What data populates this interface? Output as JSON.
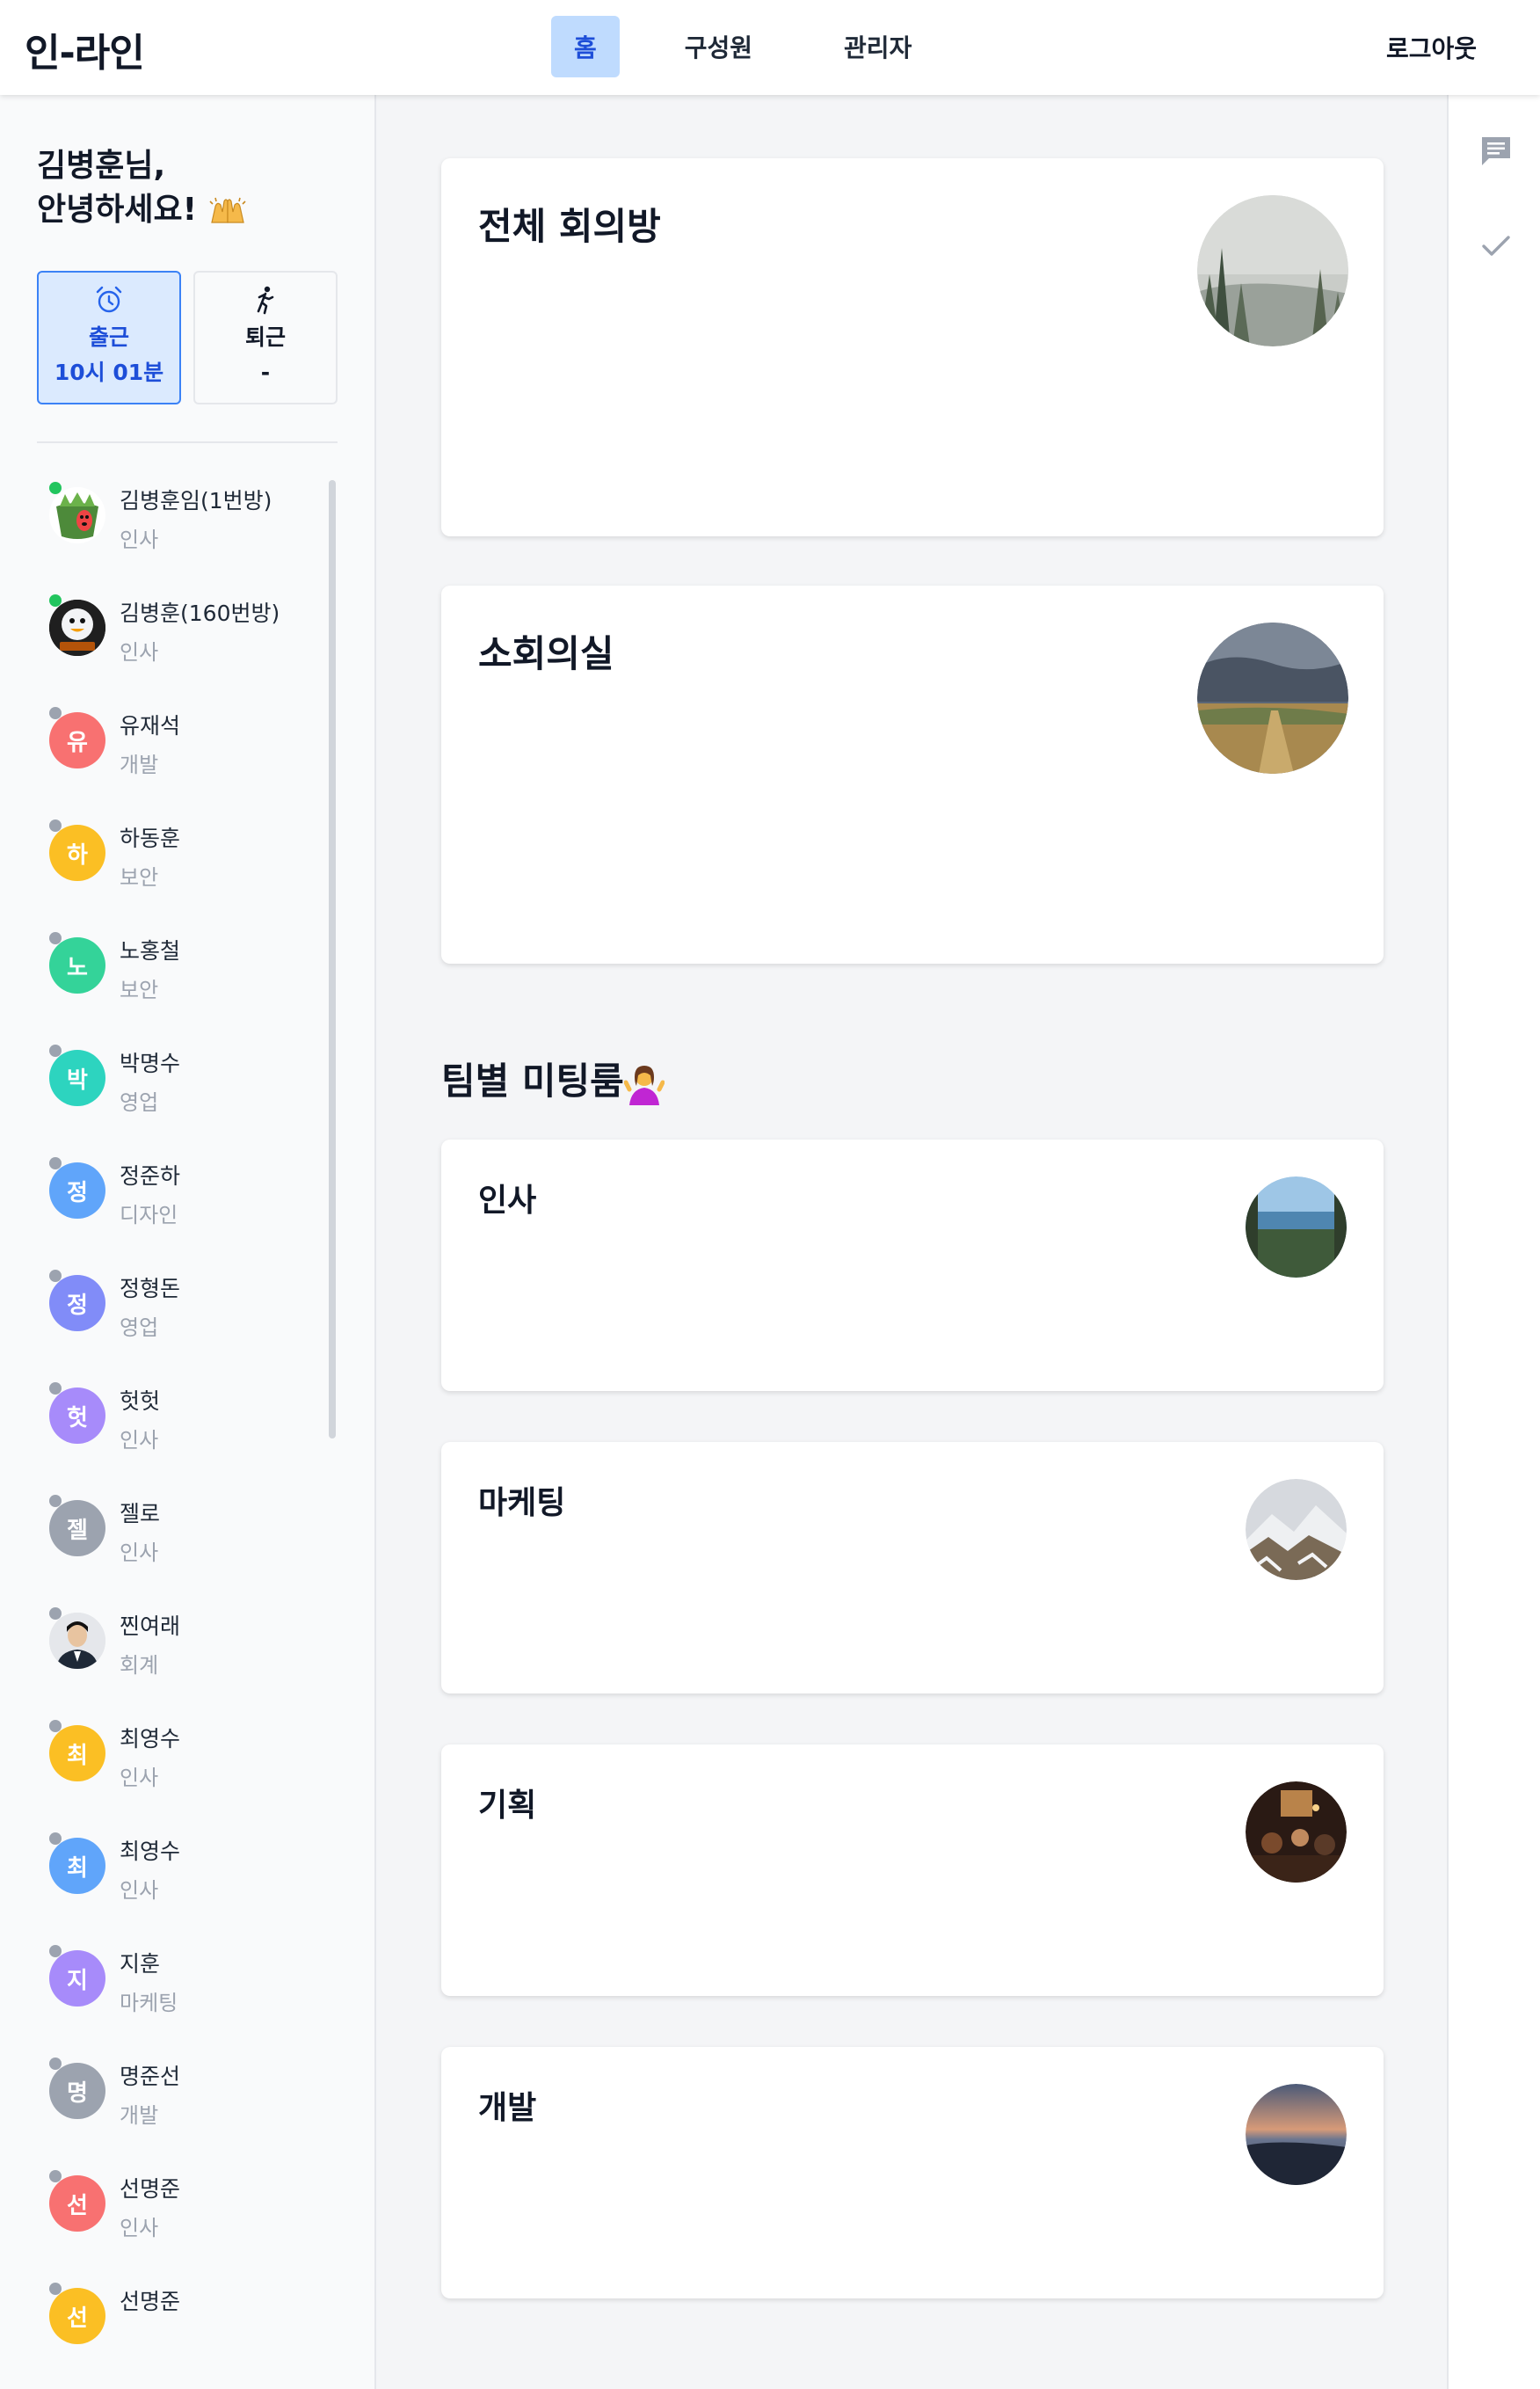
{
  "app": {
    "title": "인-라인"
  },
  "nav": {
    "items": [
      "홈",
      "구성원",
      "관리자"
    ],
    "active_index": 0,
    "logout": "로그아웃"
  },
  "colors": {
    "accent": "#3b82f6",
    "active_tab_bg": "#bfdbfe",
    "online": "#22c55e",
    "offline": "#9ca3af"
  },
  "sidebar": {
    "greeting_line1": "김병훈님,",
    "greeting_line2": "안녕하세요!",
    "greeting_icon": "raising-hands-emoji",
    "clock_in": {
      "icon": "alarm-clock-icon",
      "label": "출근",
      "time": "10시 01분"
    },
    "clock_out": {
      "icon": "walking-person-icon",
      "label": "퇴근",
      "time": "-"
    },
    "members": [
      {
        "name": "김병훈임(1번방)",
        "dept": "인사",
        "online": true,
        "avatar": "image",
        "initial": ""
      },
      {
        "name": "김병훈(160번방)",
        "dept": "인사",
        "online": true,
        "avatar": "image",
        "initial": ""
      },
      {
        "name": "유재석",
        "dept": "개발",
        "online": false,
        "avatar": "initial",
        "initial": "유",
        "color": "#f87171"
      },
      {
        "name": "하동훈",
        "dept": "보안",
        "online": false,
        "avatar": "initial",
        "initial": "하",
        "color": "#fbbf24"
      },
      {
        "name": "노홍철",
        "dept": "보안",
        "online": false,
        "avatar": "initial",
        "initial": "노",
        "color": "#34d399"
      },
      {
        "name": "박명수",
        "dept": "영업",
        "online": false,
        "avatar": "initial",
        "initial": "박",
        "color": "#2dd4bf"
      },
      {
        "name": "정준하",
        "dept": "디자인",
        "online": false,
        "avatar": "initial",
        "initial": "정",
        "color": "#60a5fa"
      },
      {
        "name": "정형돈",
        "dept": "영업",
        "online": false,
        "avatar": "initial",
        "initial": "정",
        "color": "#818cf8"
      },
      {
        "name": "헛헛",
        "dept": "인사",
        "online": false,
        "avatar": "initial",
        "initial": "헛",
        "color": "#a78bfa"
      },
      {
        "name": "젤로",
        "dept": "인사",
        "online": false,
        "avatar": "initial",
        "initial": "젤",
        "color": "#9ca3af"
      },
      {
        "name": "찐여래",
        "dept": "회계",
        "online": false,
        "avatar": "image",
        "initial": ""
      },
      {
        "name": "최영수",
        "dept": "인사",
        "online": false,
        "avatar": "initial",
        "initial": "최",
        "color": "#fbbf24"
      },
      {
        "name": "최영수",
        "dept": "인사",
        "online": false,
        "avatar": "initial",
        "initial": "최",
        "color": "#60a5fa"
      },
      {
        "name": "지훈",
        "dept": "마케팅",
        "online": false,
        "avatar": "initial",
        "initial": "지",
        "color": "#a78bfa"
      },
      {
        "name": "명준선",
        "dept": "개발",
        "online": false,
        "avatar": "initial",
        "initial": "명",
        "color": "#9ca3af"
      },
      {
        "name": "선명준",
        "dept": "인사",
        "online": false,
        "avatar": "initial",
        "initial": "선",
        "color": "#f87171"
      },
      {
        "name": "선명준",
        "dept": "",
        "online": false,
        "avatar": "initial",
        "initial": "선",
        "color": "#fbbf24"
      }
    ]
  },
  "rail": {
    "icons": [
      "chat-icon",
      "check-icon"
    ]
  },
  "main": {
    "rooms": [
      {
        "title": "전체 회의방",
        "image": "misty-forest"
      },
      {
        "title": "소회의실",
        "image": "field-under-clouds"
      }
    ],
    "team_section_title": "팀별 미팅룸",
    "team_section_icon": "shrugging-person-emoji",
    "team_rooms": [
      {
        "title": "인사",
        "image": "seaside-view"
      },
      {
        "title": "마케팅",
        "image": "snowy-mountain"
      },
      {
        "title": "기획",
        "image": "crowded-pub"
      },
      {
        "title": "개발",
        "image": "sunset-sea"
      }
    ]
  }
}
